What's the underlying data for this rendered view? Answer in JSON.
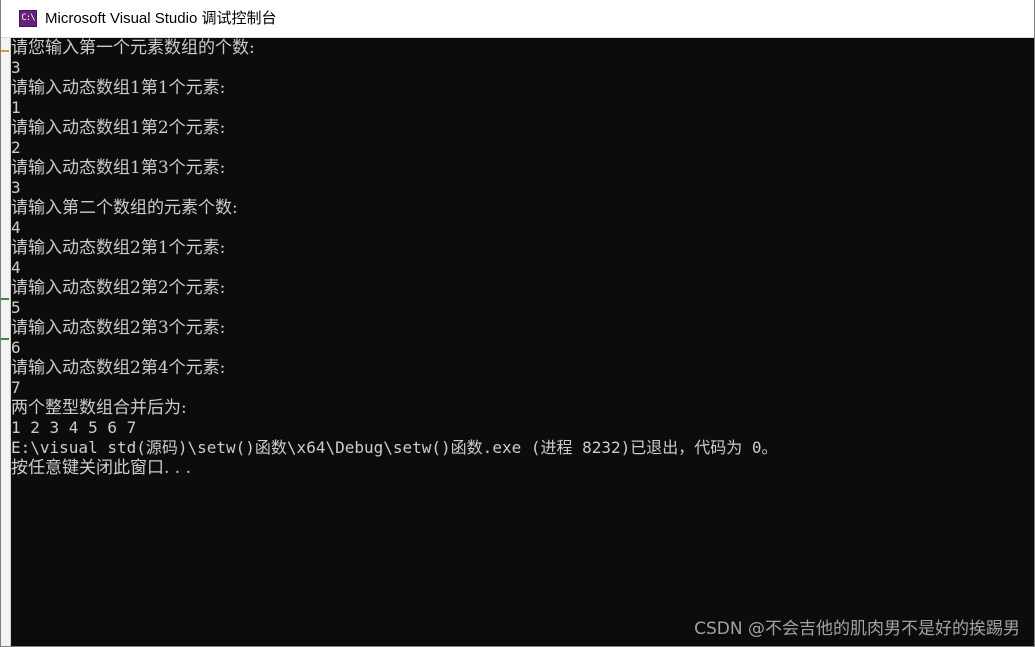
{
  "window": {
    "title": "Microsoft Visual Studio 调试控制台",
    "icon": "C:\\"
  },
  "console": {
    "lines": [
      "请您输入第一个元素数组的个数:",
      "3",
      "请输入动态数组1第1个元素:",
      "1",
      "请输入动态数组1第2个元素:",
      "2",
      "请输入动态数组1第3个元素:",
      "3",
      "请输入第二个数组的元素个数:",
      "4",
      "请输入动态数组2第1个元素:",
      "4",
      "请输入动态数组2第2个元素:",
      "5",
      "请输入动态数组2第3个元素:",
      "6",
      "请输入动态数组2第4个元素:",
      "7",
      "两个整型数组合并后为:",
      "1 2 3 4 5 6 7",
      "E:\\visual std(源码)\\setw()函数\\x64\\Debug\\setw()函数.exe (进程 8232)已退出，代码为 0。",
      "按任意键关闭此窗口. . ."
    ]
  },
  "watermark": "CSDN @不会吉他的肌肉男不是好的挨踢男"
}
